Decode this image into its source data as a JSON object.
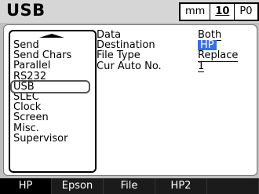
{
  "header": {
    "title": "USB",
    "units": "mm",
    "channel": "10",
    "mode": "P0"
  },
  "menu": {
    "items": [
      {
        "label": "Send"
      },
      {
        "label": "Send  Chars"
      },
      {
        "label": "Parallel"
      },
      {
        "label": "RS232"
      },
      {
        "label": "USB"
      },
      {
        "label": "SLEC"
      },
      {
        "label": "Clock"
      },
      {
        "label": "Screen"
      },
      {
        "label": "Misc."
      },
      {
        "label": "Supervisor"
      }
    ],
    "selected": "USB"
  },
  "settings": [
    {
      "label": "Data",
      "value": "Both"
    },
    {
      "label": "Destination",
      "value": "HP"
    },
    {
      "label": "File  Type",
      "value": "Replace"
    },
    {
      "label": "Cur  Auto  No.",
      "value": "1"
    }
  ],
  "softkeys": [
    {
      "label": "HP",
      "active": true
    },
    {
      "label": "Epson"
    },
    {
      "label": "File"
    },
    {
      "label": "HP2"
    },
    {
      "label": ""
    }
  ],
  "colors": {
    "highlight": "#3a6fd8",
    "softkey_active": "#000000"
  }
}
